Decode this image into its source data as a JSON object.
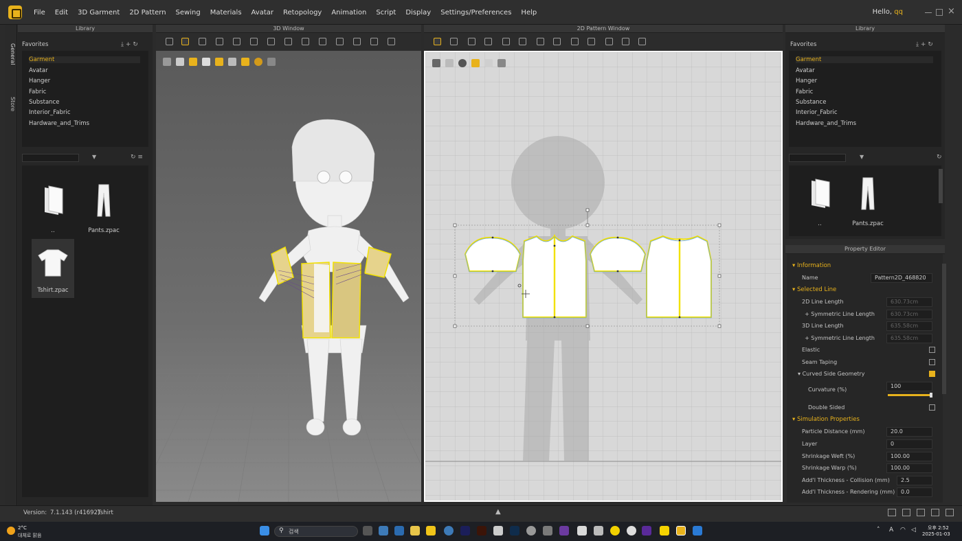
{
  "app": {
    "greeting": "Hello,",
    "user": "qq",
    "accent": "#e8b21c"
  },
  "menu": [
    "File",
    "Edit",
    "3D Garment",
    "2D Pattern",
    "Sewing",
    "Materials",
    "Avatar",
    "Retopology",
    "Animation",
    "Script",
    "Display",
    "Settings/Preferences",
    "Help"
  ],
  "side_tabs": [
    "General",
    "Store"
  ],
  "left_library": {
    "title": "Library",
    "favorites_label": "Favorites",
    "tree": [
      "Garment",
      "Avatar",
      "Hanger",
      "Fabric",
      "Substance",
      "Interior_Fabric",
      "Hardware_and_Trims"
    ],
    "selected": "Garment",
    "files": [
      {
        "name": "..",
        "icon": "folder-icon"
      },
      {
        "name": "Pants.zpac",
        "icon": "pants-icon"
      },
      {
        "name": "Tshirt.zpac",
        "icon": "tshirt-icon"
      }
    ]
  },
  "window3d": {
    "title": "3D Window"
  },
  "window2d": {
    "title": "2D Pattern Window"
  },
  "right_library": {
    "title": "Library",
    "favorites_label": "Favorites",
    "tree": [
      "Garment",
      "Avatar",
      "Hanger",
      "Fabric",
      "Substance",
      "Interior_Fabric",
      "Hardware_and_Trims"
    ],
    "selected": "Garment",
    "files": [
      {
        "name": "..",
        "icon": "folder-icon"
      },
      {
        "name": "Pants.zpac",
        "icon": "pants-icon"
      }
    ]
  },
  "property_editor": {
    "title": "Property Editor",
    "sections": {
      "information": "Information",
      "selected_line": "Selected Line",
      "curved": "Curved Side Geometry",
      "simulation": "Simulation Properties"
    },
    "name_label": "Name",
    "name_value": "Pattern2D_468820",
    "line_2d_label": "2D Line Length",
    "line_2d_value": "630.73cm",
    "sym_2d_label": "+ Symmetric Line Length",
    "sym_2d_value": "630.73cm",
    "line_3d_label": "3D Line Length",
    "line_3d_value": "635.58cm",
    "sym_3d_label": "+ Symmetric Line Length",
    "sym_3d_value": "635.58cm",
    "elastic_label": "Elastic",
    "seam_label": "Seam Taping",
    "curvature_label": "Curvature (%)",
    "curvature_value": "100",
    "curvature_level": 1.0,
    "double_label": "Double Sided",
    "particle_label": "Particle Distance (mm)",
    "particle_value": "20.0",
    "layer_label": "Layer",
    "layer_value": "0",
    "weft_label": "Shrinkage Weft (%)",
    "weft_value": "100.00",
    "warp_label": "Shrinkage Warp (%)",
    "warp_value": "100.00",
    "collision_label": "Add'l Thickness - Collision (mm)",
    "collision_value": "2.5",
    "rendering_label": "Add'l Thickness - Rendering (mm)",
    "rendering_value": "0.0"
  },
  "status": {
    "version_label": "Version:",
    "version": "7.1.143 (r41692)",
    "file": "Tshirt"
  },
  "taskbar": {
    "weather_temp": "2°C",
    "weather_desc": "대체로 맑음",
    "search": "검색",
    "time_label": "오후 2:52",
    "date": "2025-01-03"
  }
}
